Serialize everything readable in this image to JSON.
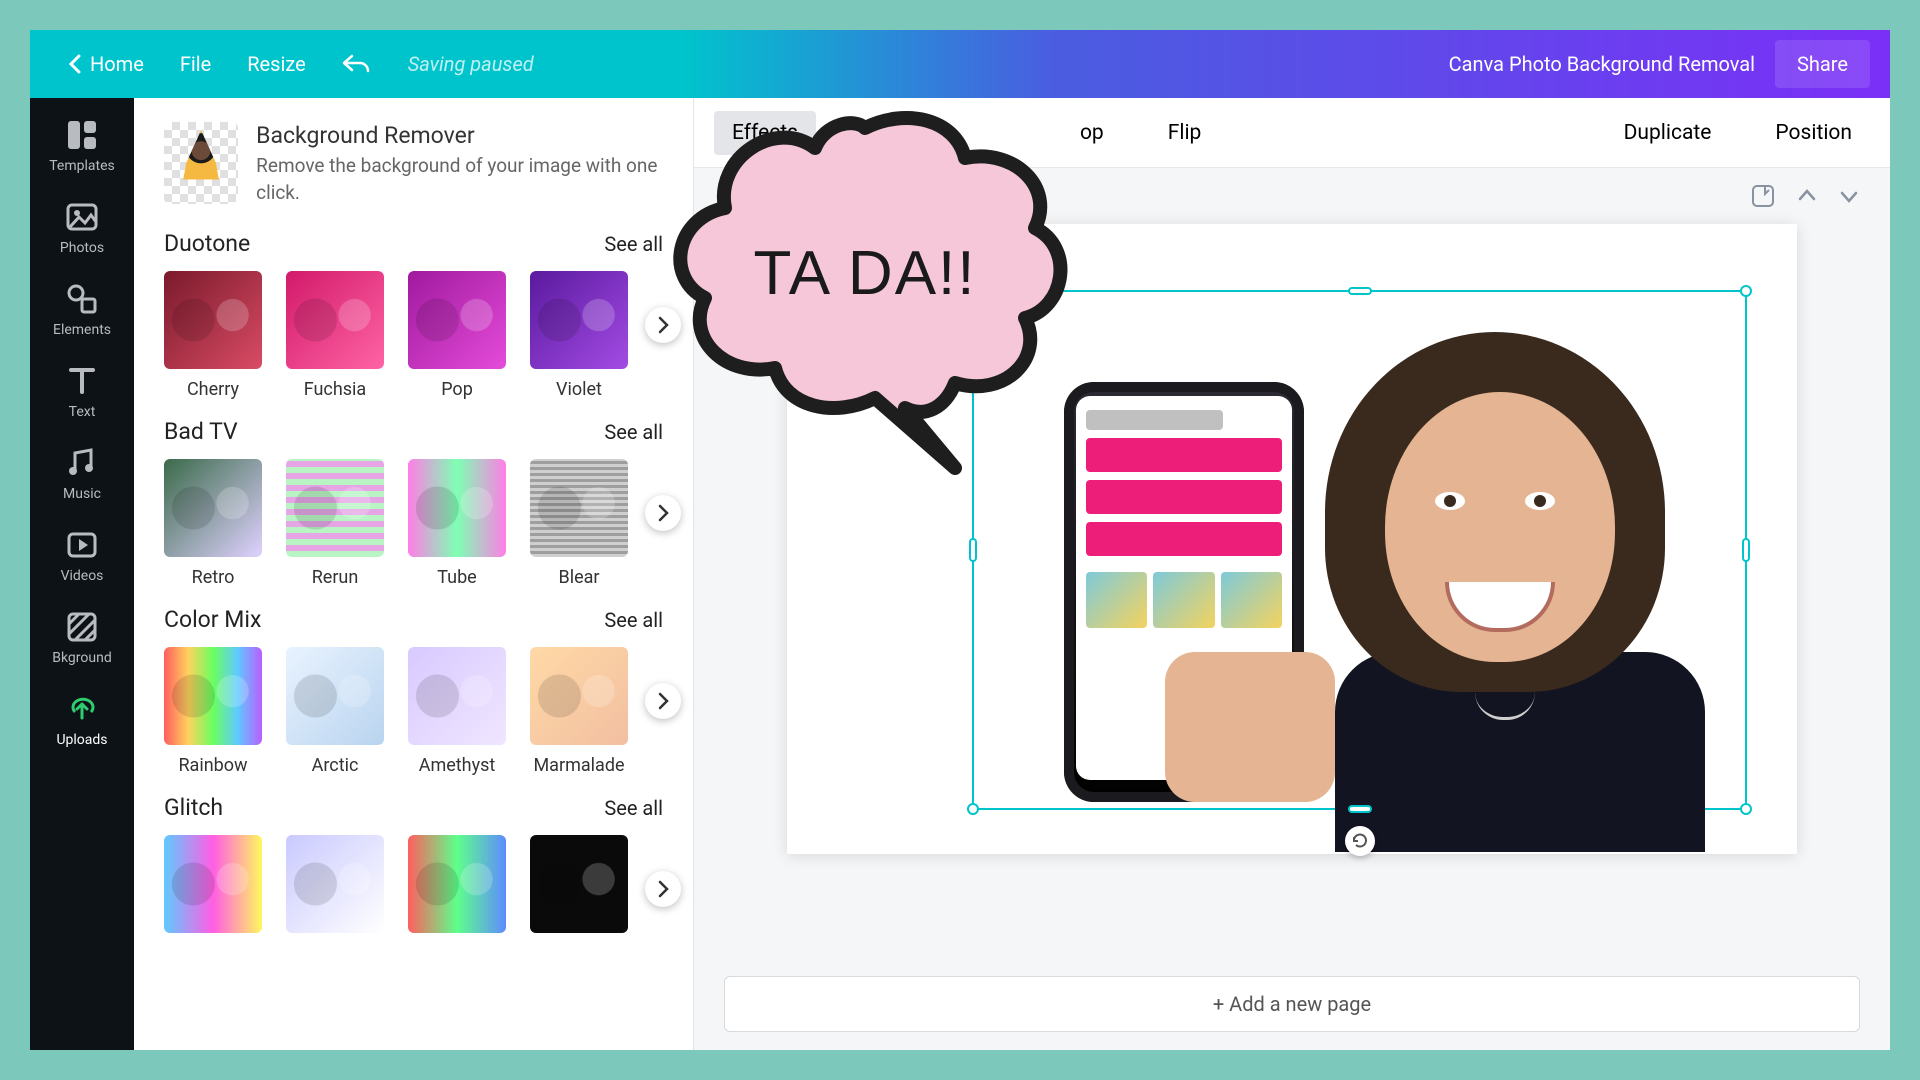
{
  "header": {
    "home": "Home",
    "file": "File",
    "resize": "Resize",
    "status": "Saving paused",
    "title": "Canva Photo Background Removal",
    "share": "Share"
  },
  "sidebar": {
    "items": [
      {
        "label": "Templates"
      },
      {
        "label": "Photos"
      },
      {
        "label": "Elements"
      },
      {
        "label": "Text"
      },
      {
        "label": "Music"
      },
      {
        "label": "Videos"
      },
      {
        "label": "Bkground"
      },
      {
        "label": "Uploads"
      }
    ]
  },
  "panel": {
    "bg_remover": {
      "title": "Background Remover",
      "desc": "Remove the background of your image with one click."
    },
    "see_all": "See all",
    "sections": [
      {
        "title": "Duotone",
        "items": [
          "Cherry",
          "Fuchsia",
          "Pop",
          "Violet"
        ],
        "tints": [
          "t-cherry",
          "t-fuchsia",
          "t-pop",
          "t-violet"
        ]
      },
      {
        "title": "Bad TV",
        "items": [
          "Retro",
          "Rerun",
          "Tube",
          "Blear"
        ],
        "tints": [
          "t-retro",
          "t-rerun",
          "t-tube",
          "t-blear"
        ]
      },
      {
        "title": "Color Mix",
        "items": [
          "Rainbow",
          "Arctic",
          "Amethyst",
          "Marmalade"
        ],
        "tints": [
          "t-rainbow",
          "t-arctic",
          "t-amethyst",
          "t-marmalade"
        ]
      },
      {
        "title": "Glitch",
        "items": [
          "",
          "",
          "",
          ""
        ],
        "tints": [
          "t-g1",
          "t-g2",
          "t-g3",
          "t-g4"
        ]
      }
    ]
  },
  "context": {
    "effects": "Effects",
    "crop_partial": "op",
    "flip": "Flip",
    "duplicate": "Duplicate",
    "position": "Position"
  },
  "canvas": {
    "add_page": "+ Add a new page"
  },
  "bubble": {
    "text": "TA DA!!"
  }
}
